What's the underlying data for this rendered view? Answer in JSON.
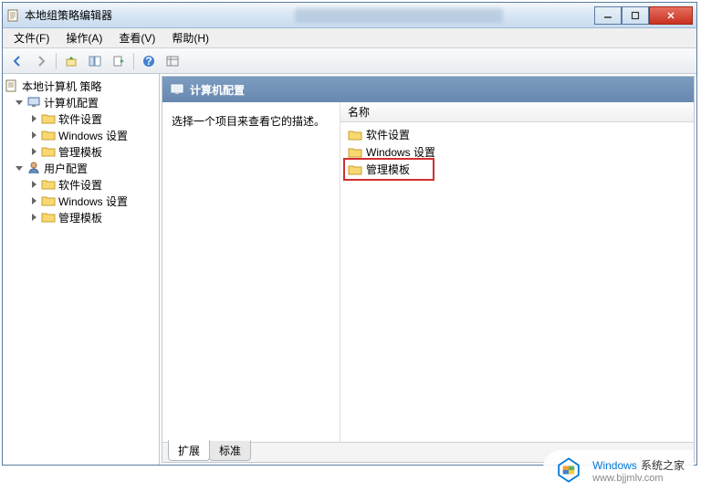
{
  "window": {
    "title": "本地组策略编辑器"
  },
  "menu": {
    "file": "文件(F)",
    "action": "操作(A)",
    "view": "查看(V)",
    "help": "帮助(H)"
  },
  "tree": {
    "root": "本地计算机 策略",
    "computer_config": "计算机配置",
    "software_settings": "软件设置",
    "windows_settings": "Windows 设置",
    "admin_templates": "管理模板",
    "user_config": "用户配置"
  },
  "detail": {
    "header": "计算机配置",
    "prompt": "选择一个项目来查看它的描述。",
    "column_name": "名称",
    "items": {
      "software": "软件设置",
      "windows": "Windows 设置",
      "templates": "管理模板"
    }
  },
  "tabs": {
    "extended": "扩展",
    "standard": "标准"
  },
  "watermark": {
    "brand_prefix": "Windows",
    "brand_suffix": "系统之家",
    "url": "www.bjjmlv.com"
  }
}
